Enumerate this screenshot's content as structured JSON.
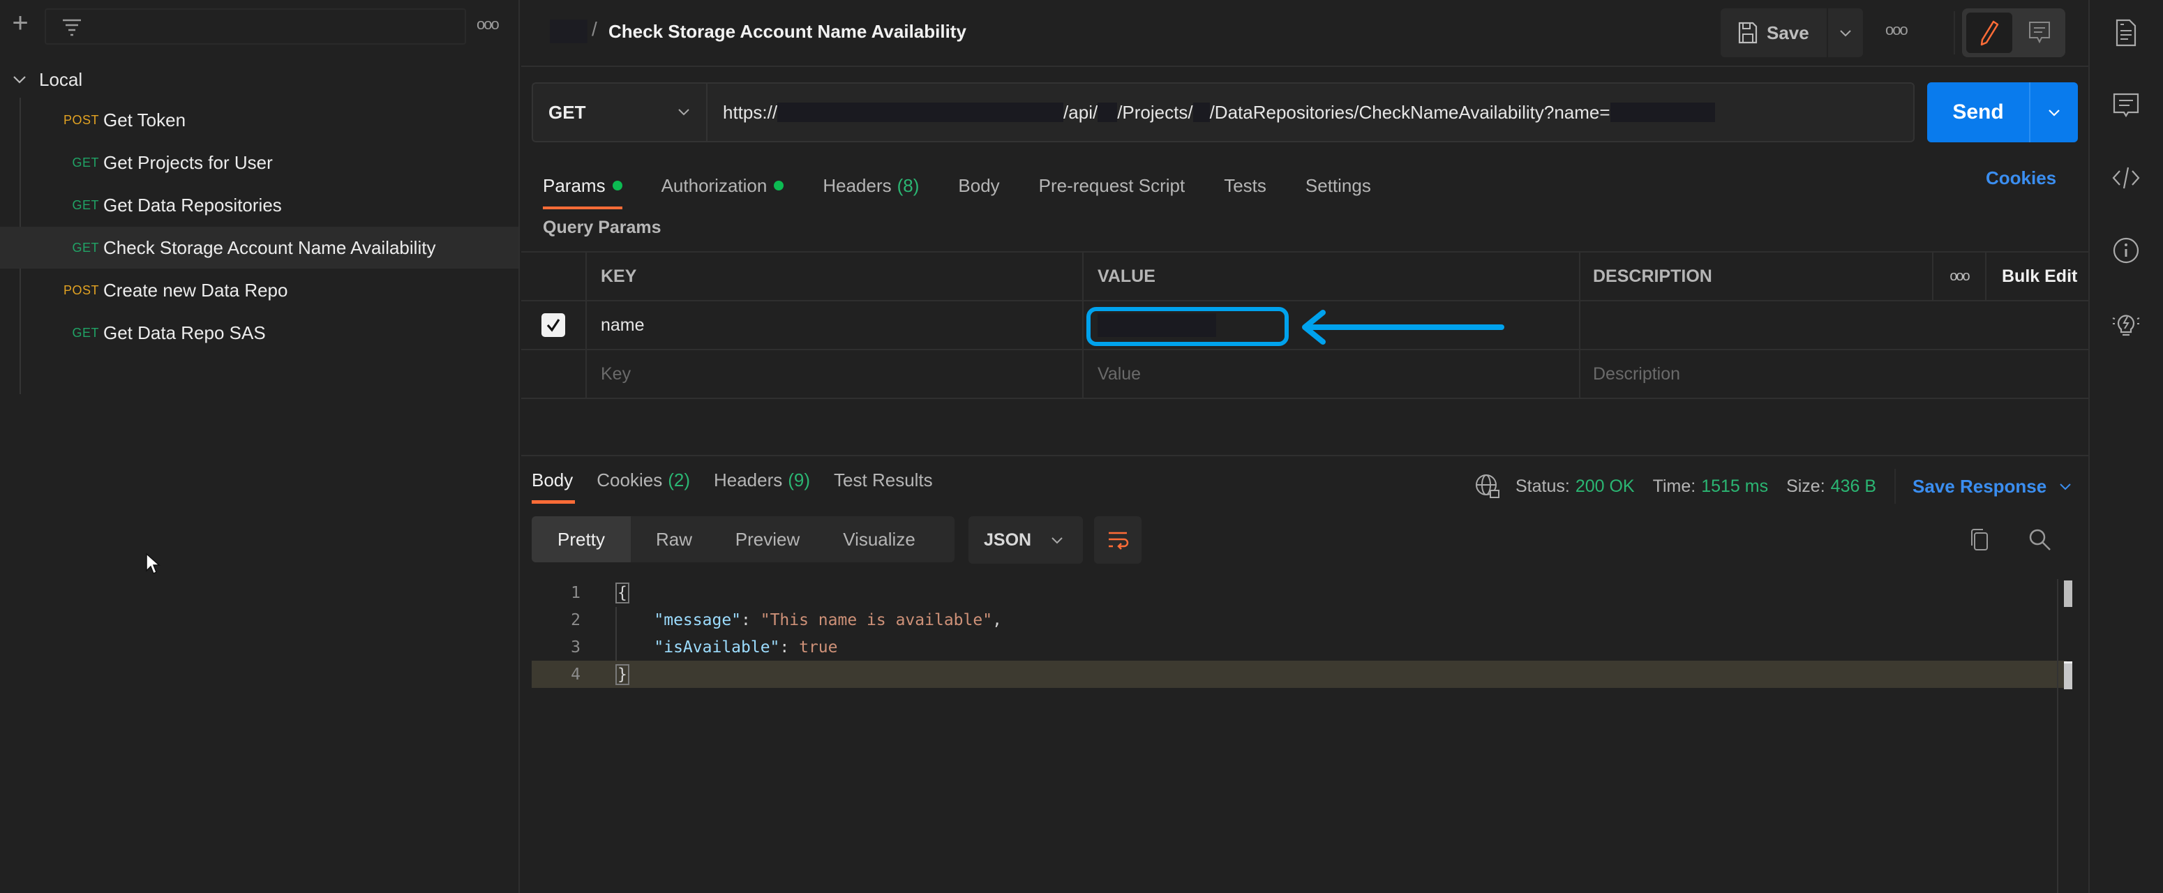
{
  "sidebar": {
    "more_label": "ooo",
    "collection": "Local",
    "requests": [
      {
        "method": "POST",
        "name": "Get Token",
        "active": false
      },
      {
        "method": "GET",
        "name": "Get Projects for User",
        "active": false
      },
      {
        "method": "GET",
        "name": "Get Data Repositories",
        "active": false
      },
      {
        "method": "GET",
        "name": "Check Storage Account Name Availability",
        "active": true
      },
      {
        "method": "POST",
        "name": "Create new Data Repo",
        "active": false
      },
      {
        "method": "GET",
        "name": "Get Data Repo SAS",
        "active": false
      }
    ]
  },
  "header": {
    "breadcrumb_sep": "/",
    "title": "Check Storage Account Name Availability",
    "save_label": "Save",
    "more_label": "ooo"
  },
  "request": {
    "method": "GET",
    "url_parts": [
      "https://",
      "/api/",
      "/Projects/",
      "/DataRepositories/CheckNameAvailability?name="
    ],
    "send_label": "Send"
  },
  "request_tabs": [
    {
      "label": "Params",
      "dot": true,
      "count": null,
      "active": true
    },
    {
      "label": "Authorization",
      "dot": true,
      "count": null,
      "active": false
    },
    {
      "label": "Headers",
      "dot": false,
      "count": "(8)",
      "active": false
    },
    {
      "label": "Body",
      "dot": false,
      "count": null,
      "active": false
    },
    {
      "label": "Pre-request Script",
      "dot": false,
      "count": null,
      "active": false
    },
    {
      "label": "Tests",
      "dot": false,
      "count": null,
      "active": false
    },
    {
      "label": "Settings",
      "dot": false,
      "count": null,
      "active": false
    }
  ],
  "cookies_link": "Cookies",
  "query_params": {
    "title": "Query Params",
    "headers": {
      "key": "KEY",
      "value": "VALUE",
      "description": "DESCRIPTION",
      "more": "ooo",
      "bulk_edit": "Bulk Edit"
    },
    "rows": [
      {
        "checked": true,
        "key": "name",
        "value": "",
        "description": ""
      }
    ],
    "placeholders": {
      "key": "Key",
      "value": "Value",
      "description": "Description"
    }
  },
  "response": {
    "tabs": [
      {
        "label": "Body",
        "count": null,
        "active": true
      },
      {
        "label": "Cookies",
        "count": "(2)",
        "active": false
      },
      {
        "label": "Headers",
        "count": "(9)",
        "active": false
      },
      {
        "label": "Test Results",
        "count": null,
        "active": false
      }
    ],
    "status_label": "Status:",
    "status_value": "200 OK",
    "time_label": "Time:",
    "time_value": "1515 ms",
    "size_label": "Size:",
    "size_value": "436 B",
    "save_response": "Save Response",
    "views": [
      "Pretty",
      "Raw",
      "Preview",
      "Visualize"
    ],
    "active_view": "Pretty",
    "format": "JSON",
    "code_lines": [
      {
        "n": "1"
      },
      {
        "n": "2",
        "key": "\"message\"",
        "val": "\"This name is available\"",
        "trail": ","
      },
      {
        "n": "3",
        "key": "\"isAvailable\"",
        "val": "true",
        "trail": ""
      },
      {
        "n": "4"
      }
    ]
  },
  "colors": {
    "accent_orange": "#ff6c37",
    "send_blue": "#097bed",
    "link_blue": "#3b8ef0",
    "success_green": "#2bb673",
    "post_method": "#e3a322",
    "get_method": "#21a366",
    "annotation_blue": "#00a2ed"
  }
}
